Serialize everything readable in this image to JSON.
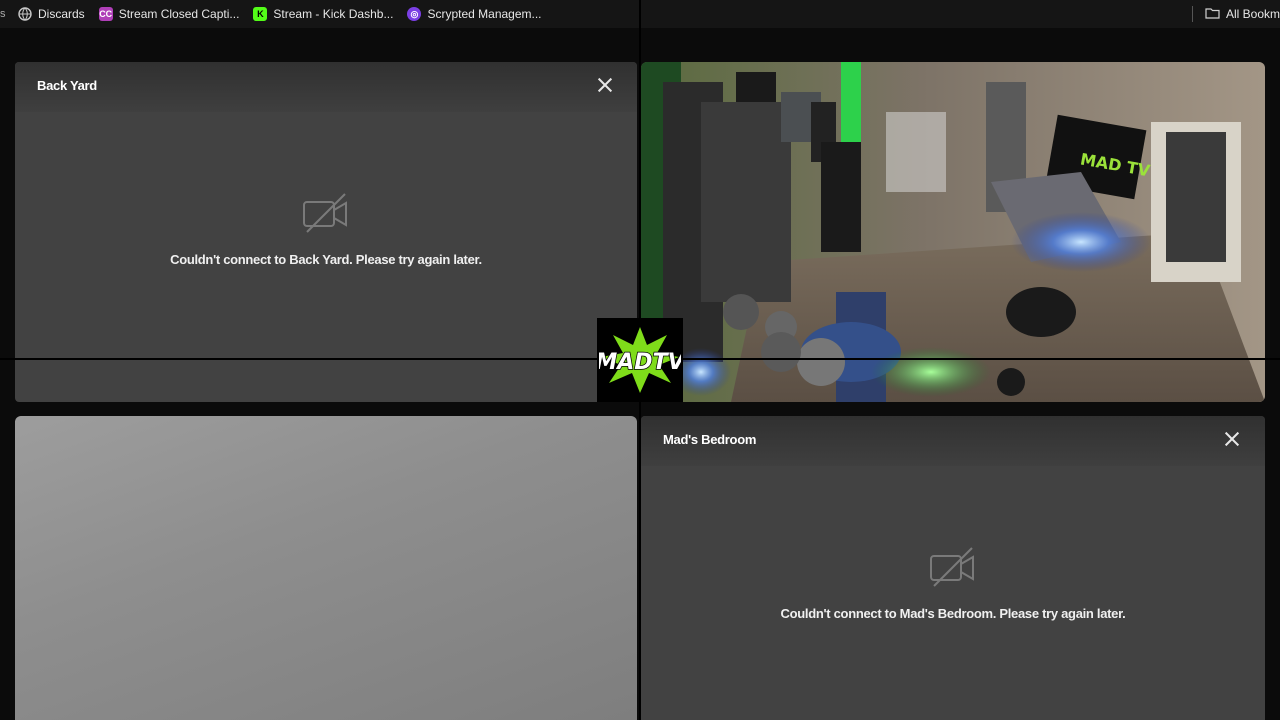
{
  "bookmarks": [
    {
      "label": "Discards",
      "icon": "globe-icon",
      "color": "#9e9e9e"
    },
    {
      "label": "Stream Closed Capti...",
      "icon": "captions-icon",
      "color": "#b03fb8"
    },
    {
      "label": "Stream - Kick Dashb...",
      "icon": "kick-icon",
      "color": "#53fc18"
    },
    {
      "label": "Scrypted Managem...",
      "icon": "scrypted-icon",
      "color": "#7b3fe4"
    }
  ],
  "all_bookmarks": "All Bookm",
  "cameras": {
    "back_yard": {
      "title": "Back Yard",
      "error": "Couldn't connect to Back Yard. Please try again later."
    },
    "mads_bedroom": {
      "title": "Mad's Bedroom",
      "error": "Couldn't connect to Mad's Bedroom. Please try again later."
    }
  },
  "logo": {
    "text": "MADTV",
    "accent": "#7fdc1a"
  },
  "colors": {
    "panel": "#424242",
    "accent_green": "#7fdc1a"
  }
}
